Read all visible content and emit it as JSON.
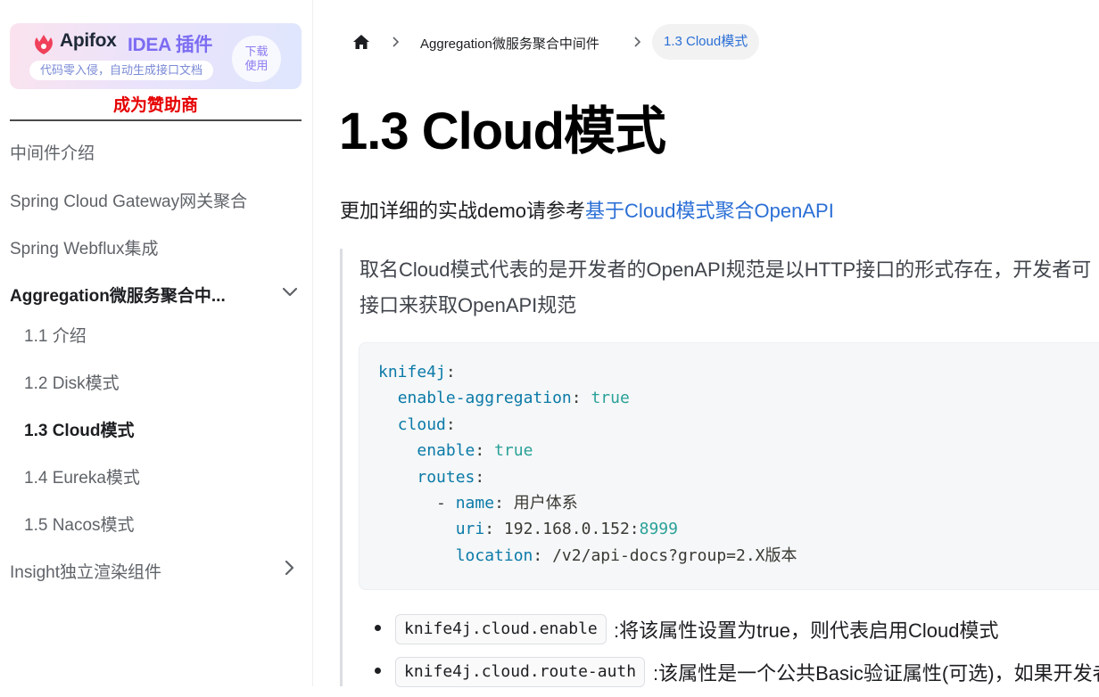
{
  "sidebar": {
    "ad": {
      "brand": "Apifox",
      "brand_suffix": "IDEA 插件",
      "tagline": "代码零入侵，自动生成接口文档",
      "button_line1": "下载",
      "button_line2": "使用"
    },
    "sponsor": "成为赞助商",
    "items": [
      {
        "label": "中间件介绍"
      },
      {
        "label": "Spring Cloud Gateway网关聚合"
      },
      {
        "label": "Spring Webflux集成"
      },
      {
        "label": "Aggregation微服务聚合中..."
      },
      {
        "label": "Insight独立渲染组件"
      }
    ],
    "sub_items": [
      {
        "label": "1.1 介绍"
      },
      {
        "label": "1.2 Disk模式"
      },
      {
        "label": "1.3 Cloud模式"
      },
      {
        "label": "1.4 Eureka模式"
      },
      {
        "label": "1.5 Nacos模式"
      }
    ]
  },
  "breadcrumb": {
    "parent": "Aggregation微服务聚合中间件",
    "current": "1.3 Cloud模式"
  },
  "page": {
    "title": "1.3 Cloud模式",
    "intro_text": "更加详细的实战demo请参考",
    "intro_link": "基于Cloud模式聚合OpenAPI",
    "quote_line1": "取名Cloud模式代表的是开发者的OpenAPI规范是以HTTP接口的形式存在，开发者可",
    "quote_line2": "接口来获取OpenAPI规范"
  },
  "code": {
    "k_knife4j": "knife4j",
    "k_enable_agg": "enable-aggregation",
    "v_true1": "true",
    "k_cloud": "cloud",
    "k_enable": "enable",
    "v_true2": "true",
    "k_routes": "routes",
    "k_name": "name",
    "v_name": "用户体系",
    "k_uri": "uri",
    "v_uri_host": "192.168.0.152:",
    "v_uri_port": "8999",
    "k_location": "location",
    "v_location": "/v2/api-docs?group=2.X版本"
  },
  "bullets": [
    {
      "code": "knife4j.cloud.enable",
      "text": ":将该属性设置为true，则代表启用Cloud模式"
    },
    {
      "code": "knife4j.cloud.route-auth",
      "text": ":该属性是一个公共Basic验证属性(可选)，如果开发者"
    }
  ],
  "colors": {
    "link": "#2b6fd6",
    "sponsor": "#e60000",
    "code_key": "#0a7aa8",
    "code_value": "#2aa198"
  }
}
